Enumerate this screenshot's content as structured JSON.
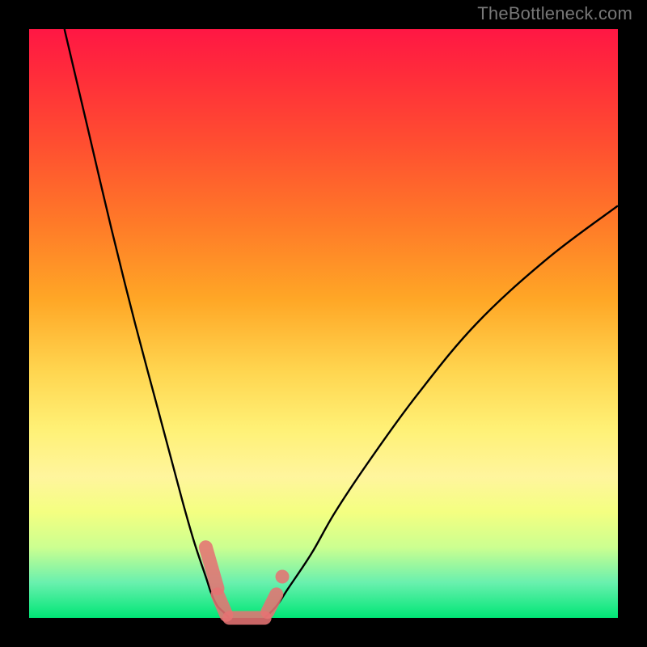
{
  "watermark": "TheBottleneck.com",
  "chart_data": {
    "type": "line",
    "title": "",
    "xlabel": "",
    "ylabel": "",
    "xlim": [
      0,
      100
    ],
    "ylim": [
      0,
      100
    ],
    "grid": false,
    "legend": false,
    "background": "rainbow-gradient-vertical",
    "background_colors": [
      "#ff1744",
      "#ff7a28",
      "#fff176",
      "#00e676"
    ],
    "series": [
      {
        "name": "left-curve",
        "x": [
          6,
          10,
          14,
          18,
          22,
          26,
          28,
          30,
          31,
          32,
          33,
          34
        ],
        "values": [
          100,
          83,
          66,
          50,
          35,
          20,
          13,
          7,
          4,
          2,
          1,
          0
        ]
      },
      {
        "name": "right-curve",
        "x": [
          40,
          42,
          44,
          48,
          52,
          58,
          66,
          76,
          88,
          100
        ],
        "values": [
          0,
          2,
          5,
          11,
          18,
          27,
          38,
          50,
          61,
          70
        ]
      }
    ],
    "markers": [
      {
        "name": "left-marker-upper",
        "shape": "rounded-segment",
        "x": [
          30,
          32
        ],
        "values": [
          12,
          5
        ],
        "color": "#e57373"
      },
      {
        "name": "left-marker-lower",
        "shape": "rounded-segment",
        "x": [
          32,
          33.5
        ],
        "values": [
          4,
          0.5
        ],
        "color": "#e57373"
      },
      {
        "name": "bottom-bridge",
        "shape": "rounded-segment",
        "x": [
          34,
          40
        ],
        "values": [
          0,
          0
        ],
        "color": "#e57373"
      },
      {
        "name": "right-marker-lower",
        "shape": "rounded-segment",
        "x": [
          40.5,
          42
        ],
        "values": [
          1,
          4
        ],
        "color": "#e57373"
      },
      {
        "name": "right-marker-upper",
        "shape": "dot",
        "x": [
          43
        ],
        "values": [
          7
        ],
        "color": "#e57373"
      }
    ]
  }
}
